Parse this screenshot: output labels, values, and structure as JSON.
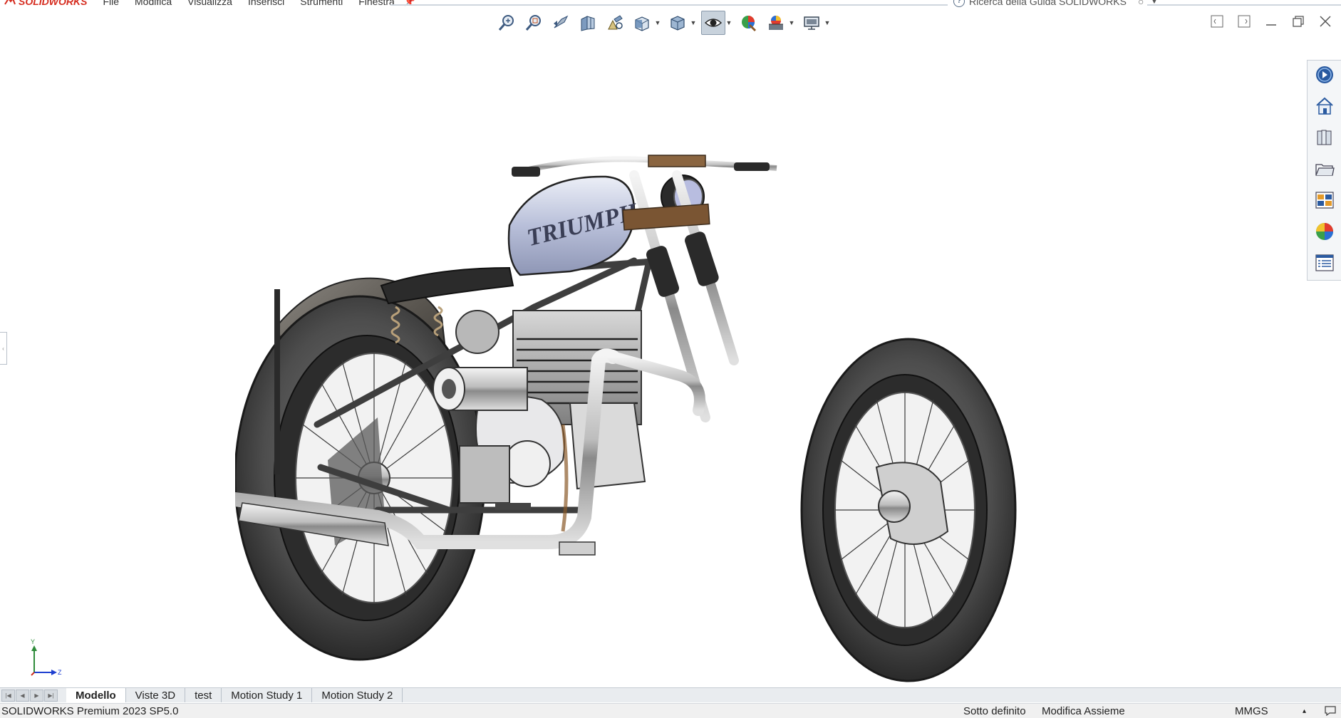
{
  "app": {
    "logo_text": "SOLIDWORKS",
    "menu": [
      "File",
      "Modifica",
      "Visualizza",
      "Inserisci",
      "Strumenti",
      "Finestra"
    ],
    "help_search": "Ricerca della Guida SOLIDWORKS"
  },
  "hud_toolbar": {
    "tools": [
      "zoom-to-fit-icon",
      "zoom-to-area-icon",
      "previous-view-icon",
      "section-view-icon",
      "dynamic-annotation-icon",
      "view-orientation-icon",
      "display-style-icon",
      "hide-show-items-icon",
      "edit-appearance-icon",
      "apply-scene-icon",
      "view-settings-icon"
    ]
  },
  "tabs": [
    {
      "label": "Modello",
      "active": true
    },
    {
      "label": "Viste 3D",
      "active": false
    },
    {
      "label": "test",
      "active": false
    },
    {
      "label": "Motion Study 1",
      "active": false
    },
    {
      "label": "Motion Study 2",
      "active": false
    }
  ],
  "status": {
    "product": "SOLIDWORKS Premium 2023 SP5.0",
    "definition": "Sotto definito",
    "mode": "Modifica Assieme",
    "units": "MMGS",
    "units_arrow": "▴"
  },
  "triad": {
    "y_label": "Y",
    "z_label": "Z"
  },
  "model": {
    "tank_text": "TRIUMPH"
  },
  "colors": {
    "accent": "#d52b1e",
    "tab_bg": "#e9ecef",
    "axis_y": "#2e8b3a",
    "axis_z": "#1e3fd0"
  }
}
